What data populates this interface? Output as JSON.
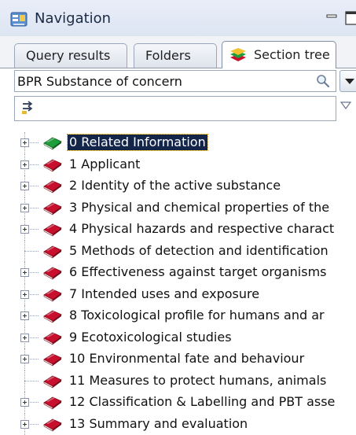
{
  "window": {
    "title": "Navigation"
  },
  "tabs": [
    {
      "label": "Query results",
      "active": false
    },
    {
      "label": "Folders",
      "active": false
    },
    {
      "label": "Section tree",
      "active": true
    }
  ],
  "search": {
    "value": "BPR Substance of concern"
  },
  "icons": {
    "app": "navigation-icon",
    "search": "magnifier-icon",
    "filter": "filter-icon",
    "book_closed": "red-book-icon",
    "book_open": "green-book-icon"
  },
  "colors": {
    "selection_background": "#14254a",
    "selection_outline": "#e3a020",
    "book_red": "#c8102e",
    "book_green": "#1e9e3a"
  },
  "tree": {
    "selected_index": 0,
    "items": [
      {
        "label": "0 Related Information",
        "expandable": true,
        "icon": "green-book-icon"
      },
      {
        "label": "1 Applicant",
        "expandable": true,
        "icon": "red-book-icon"
      },
      {
        "label": "2 Identity of the active substance",
        "expandable": true,
        "icon": "red-book-icon"
      },
      {
        "label": "3 Physical and chemical properties of the",
        "expandable": true,
        "icon": "red-book-icon"
      },
      {
        "label": "4 Physical hazards and respective charact",
        "expandable": true,
        "icon": "red-book-icon"
      },
      {
        "label": "5 Methods of detection and identification",
        "expandable": false,
        "icon": "red-book-icon"
      },
      {
        "label": "6 Effectiveness against target organisms",
        "expandable": true,
        "icon": "red-book-icon"
      },
      {
        "label": "7 Intended uses and exposure",
        "expandable": true,
        "icon": "red-book-icon"
      },
      {
        "label": "8 Toxicological profile for humans and ar",
        "expandable": true,
        "icon": "red-book-icon"
      },
      {
        "label": "9 Ecotoxicological studies",
        "expandable": true,
        "icon": "red-book-icon"
      },
      {
        "label": "10 Environmental fate and behaviour",
        "expandable": true,
        "icon": "red-book-icon"
      },
      {
        "label": "11 Measures to protect humans, animals",
        "expandable": false,
        "icon": "red-book-icon"
      },
      {
        "label": "12 Classification & Labelling and PBT asse",
        "expandable": true,
        "icon": "red-book-icon"
      },
      {
        "label": "13 Summary and evaluation",
        "expandable": true,
        "icon": "red-book-icon"
      }
    ]
  }
}
